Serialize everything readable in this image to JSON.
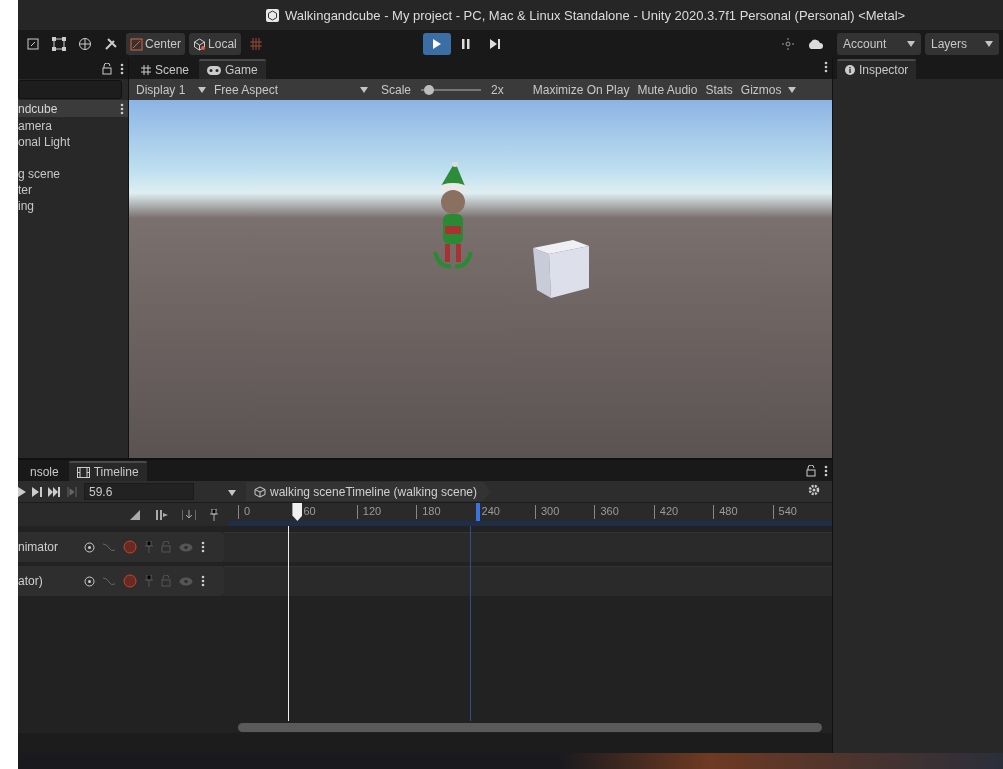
{
  "window": {
    "title": "Walkingandcube - My project - PC, Mac & Linux Standalone - Unity 2020.3.7f1 Personal (Personal) <Metal>"
  },
  "toolbar": {
    "pivot_buttons": [
      {
        "label": "Center",
        "kind": "center"
      },
      {
        "label": "Local",
        "kind": "local"
      }
    ],
    "play_controls": [
      {
        "kind": "play",
        "selected": true
      },
      {
        "kind": "pause",
        "selected": false
      },
      {
        "kind": "step",
        "selected": false
      }
    ],
    "dropdowns": [
      "Account",
      "Layers"
    ]
  },
  "hierarchy": {
    "header": "ndcube",
    "items": [
      {
        "label": "amera",
        "gap_before": false
      },
      {
        "label": "onal Light",
        "gap_before": false
      },
      {
        "label": "g scene",
        "gap_before": true
      },
      {
        "label": "ter",
        "gap_before": false
      },
      {
        "label": "ing",
        "gap_before": false
      }
    ]
  },
  "view_tabs": [
    {
      "label": "Scene",
      "kind": "scene",
      "selected": false
    },
    {
      "label": "Game",
      "kind": "game",
      "selected": true
    }
  ],
  "game_toolbar": {
    "display": "Display 1",
    "aspect": "Free Aspect",
    "scale_label": "Scale",
    "scale": {
      "level": 0.05
    },
    "scale_reading": "2x",
    "toggles": [
      "Maximize On Play",
      "Mute Audio",
      "Stats"
    ],
    "gizmos": "Gizmos"
  },
  "inspector": {
    "tab": "Inspector"
  },
  "bottom_tabs": [
    {
      "label": "nsole",
      "kind": "console",
      "selected": false
    },
    {
      "label": "Timeline",
      "kind": "timeline",
      "selected": true
    }
  ],
  "timeline": {
    "frame": "59.6",
    "breadcrumb": "walking sceneTimeline (walking scene)",
    "ruler": [
      "0",
      "60",
      "120",
      "180",
      "240",
      "300",
      "360",
      "420",
      "480",
      "540"
    ],
    "playhead": {
      "level": 0.1
    },
    "end_marker": {
      "level": 0.4
    },
    "tracks": [
      {
        "label": "nimator"
      },
      {
        "label": "ator)"
      }
    ]
  }
}
